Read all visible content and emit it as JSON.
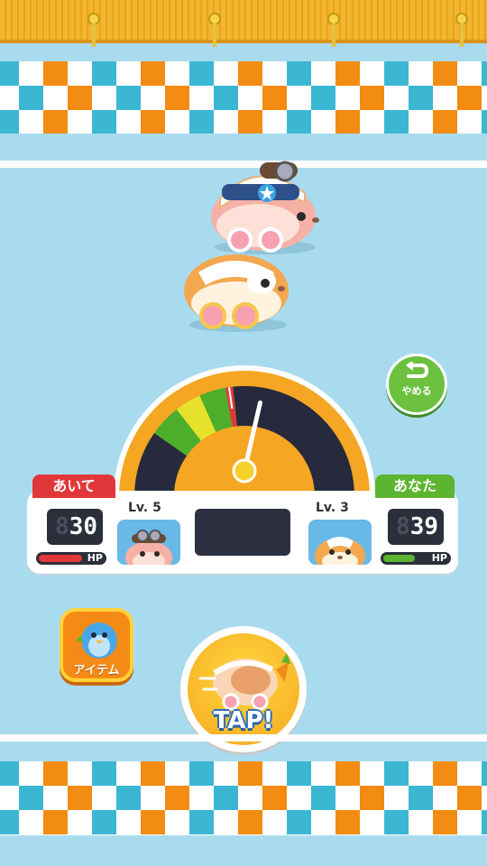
{
  "opponent": {
    "tag_label": "あいて",
    "level_label": "Lv. 5",
    "hp_ghost": "8",
    "hp_value": "30",
    "hp_label": "HP",
    "hp_fraction": 0.96,
    "tag_color": "#e2373a"
  },
  "player": {
    "tag_label": "あなた",
    "level_label": "Lv. 3",
    "hp_ghost": "8",
    "hp_value": "39",
    "hp_label": "HP",
    "hp_fraction": 0.7,
    "tag_color": "#5cb531"
  },
  "buttons": {
    "quit_label": "やめる",
    "item_label": "アイテム",
    "tap_label": "TAP!"
  },
  "gauge": {
    "needle_fraction": 0.62,
    "zones": [
      "dark",
      "green",
      "yellow",
      "green",
      "red",
      "dark"
    ]
  },
  "colors": {
    "background": "#a9dbef",
    "checker_blue": "#3cb7d3",
    "checker_orange": "#f28c12",
    "gauge_orange": "#f5a623"
  },
  "icons": {
    "quit": "return-arrow-icon",
    "item": "penguin-icon"
  }
}
